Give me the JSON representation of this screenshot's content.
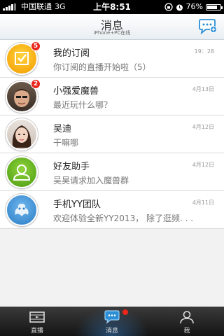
{
  "status_bar": {
    "carrier": "中国联通",
    "network": "3G",
    "time": "上午8:51",
    "battery": "76%",
    "battery_level": 0.76
  },
  "header": {
    "title": "消息",
    "subtitle": "iPhone+PC在线",
    "compose_icon": "chat-bubble-icon"
  },
  "conversations": [
    {
      "name": "我的订阅",
      "time": "19：28",
      "preview": "你订阅的直播开始啦（5）",
      "badge": "5",
      "avatar": "subscription-icon"
    },
    {
      "name": "小强爱魔兽",
      "time": "4月13日",
      "preview": "最近玩什么哪？",
      "badge": "2",
      "avatar": "user-photo"
    },
    {
      "name": "吴迪",
      "time": "4月12日",
      "preview": "干嘛哪",
      "avatar": "user-photo"
    },
    {
      "name": "好友助手",
      "time": "4月12日",
      "preview": "吴昊请求加入魔兽群",
      "avatar": "friend-assistant-icon"
    },
    {
      "name": "手机YY团队",
      "time": "4月11日",
      "preview": "欢迎体验全新YY2013， 除了逛频. . .",
      "avatar": "yy-team-icon"
    }
  ],
  "tabs": [
    {
      "label": "直播",
      "icon": "film-icon"
    },
    {
      "label": "消息",
      "icon": "message-icon",
      "active": true
    },
    {
      "label": "我",
      "icon": "person-icon"
    }
  ],
  "colors": {
    "badge": "#e8261c",
    "tabbar": "#1e1e1e",
    "accent": "#2c8fd6"
  }
}
